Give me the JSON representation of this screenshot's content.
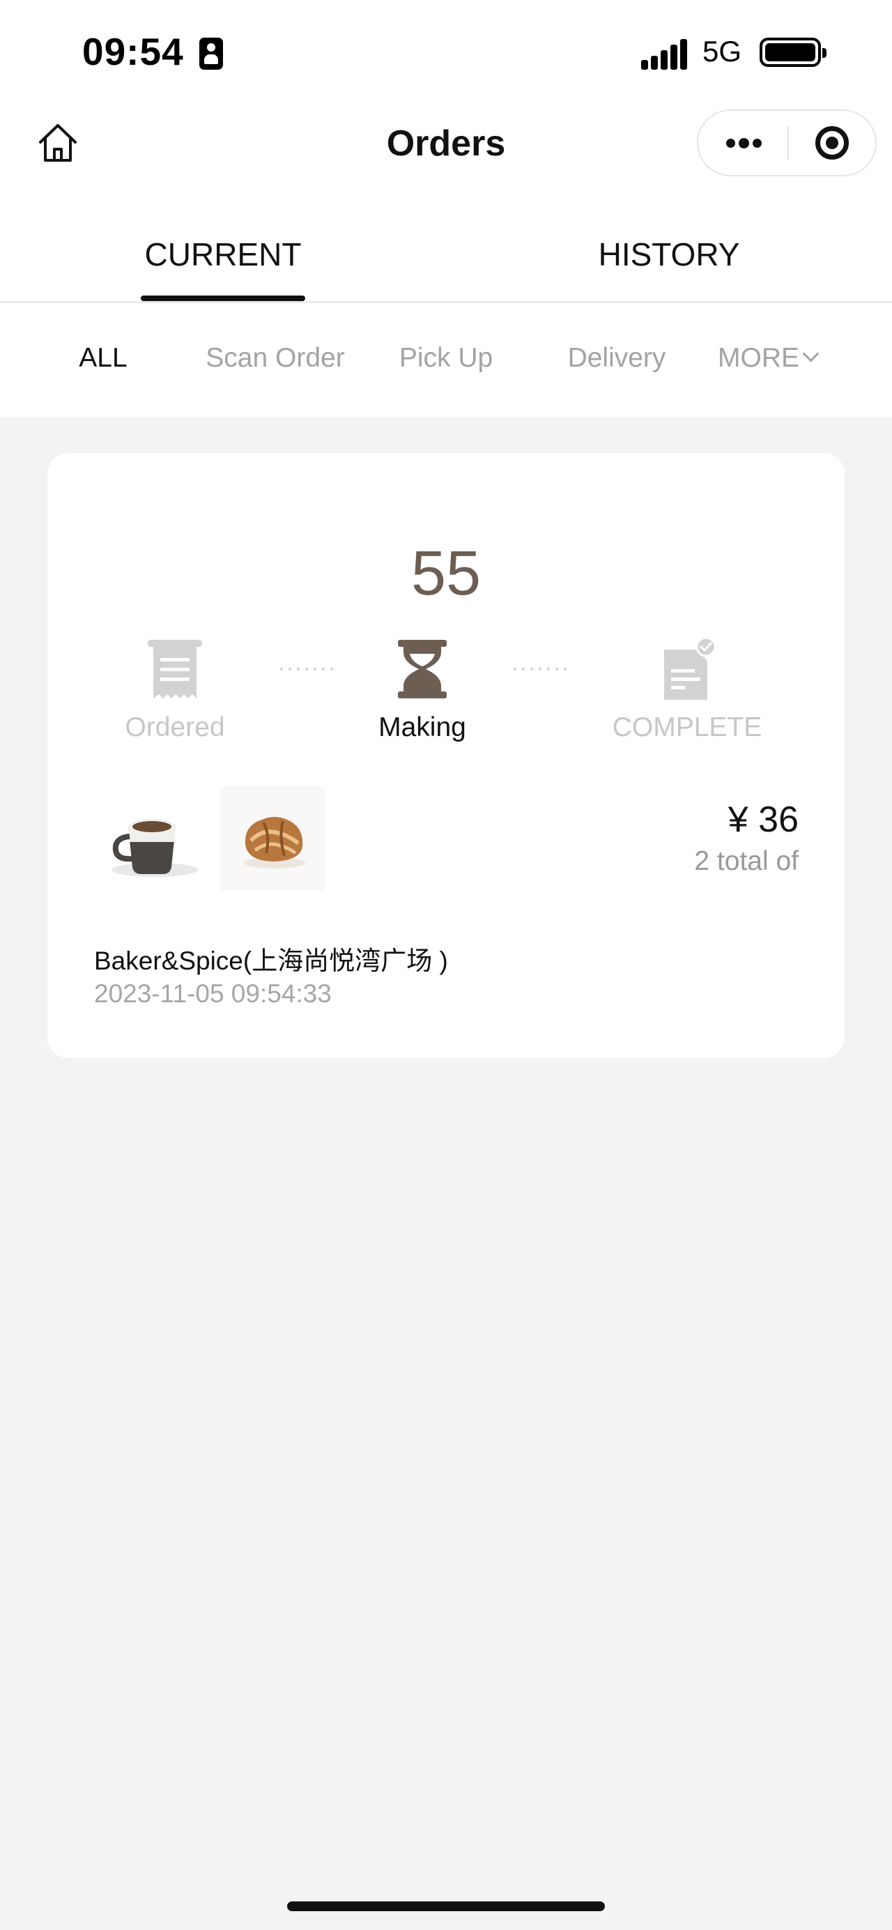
{
  "status_bar": {
    "time": "09:54",
    "network": "5G"
  },
  "nav": {
    "title": "Orders"
  },
  "tabs": [
    {
      "label": "CURRENT",
      "active": true
    },
    {
      "label": "HISTORY",
      "active": false
    }
  ],
  "filters": [
    {
      "label": "ALL",
      "active": true
    },
    {
      "label": "Scan Order",
      "active": false
    },
    {
      "label": "Pick Up",
      "active": false
    },
    {
      "label": "Delivery",
      "active": false
    },
    {
      "label": "MORE",
      "active": false
    }
  ],
  "order": {
    "number": "55",
    "steps": [
      {
        "label": "Ordered",
        "icon": "receipt-icon",
        "active": false
      },
      {
        "label": "Making",
        "icon": "hourglass-icon",
        "active": true
      },
      {
        "label": "COMPLETE",
        "icon": "document-check-icon",
        "active": false
      }
    ],
    "items": [
      {
        "icon": "coffee-cup-image"
      },
      {
        "icon": "croissant-image"
      }
    ],
    "price": "¥ 36",
    "count_text": "2 total of",
    "store": "Baker&Spice(上海尚悦湾广场 )",
    "time": "2023-11-05 09:54:33"
  },
  "colors": {
    "accent_brown": "#6d5e54",
    "inactive_gray": "#c7c7c7",
    "page_bg": "#f3f3f3"
  }
}
